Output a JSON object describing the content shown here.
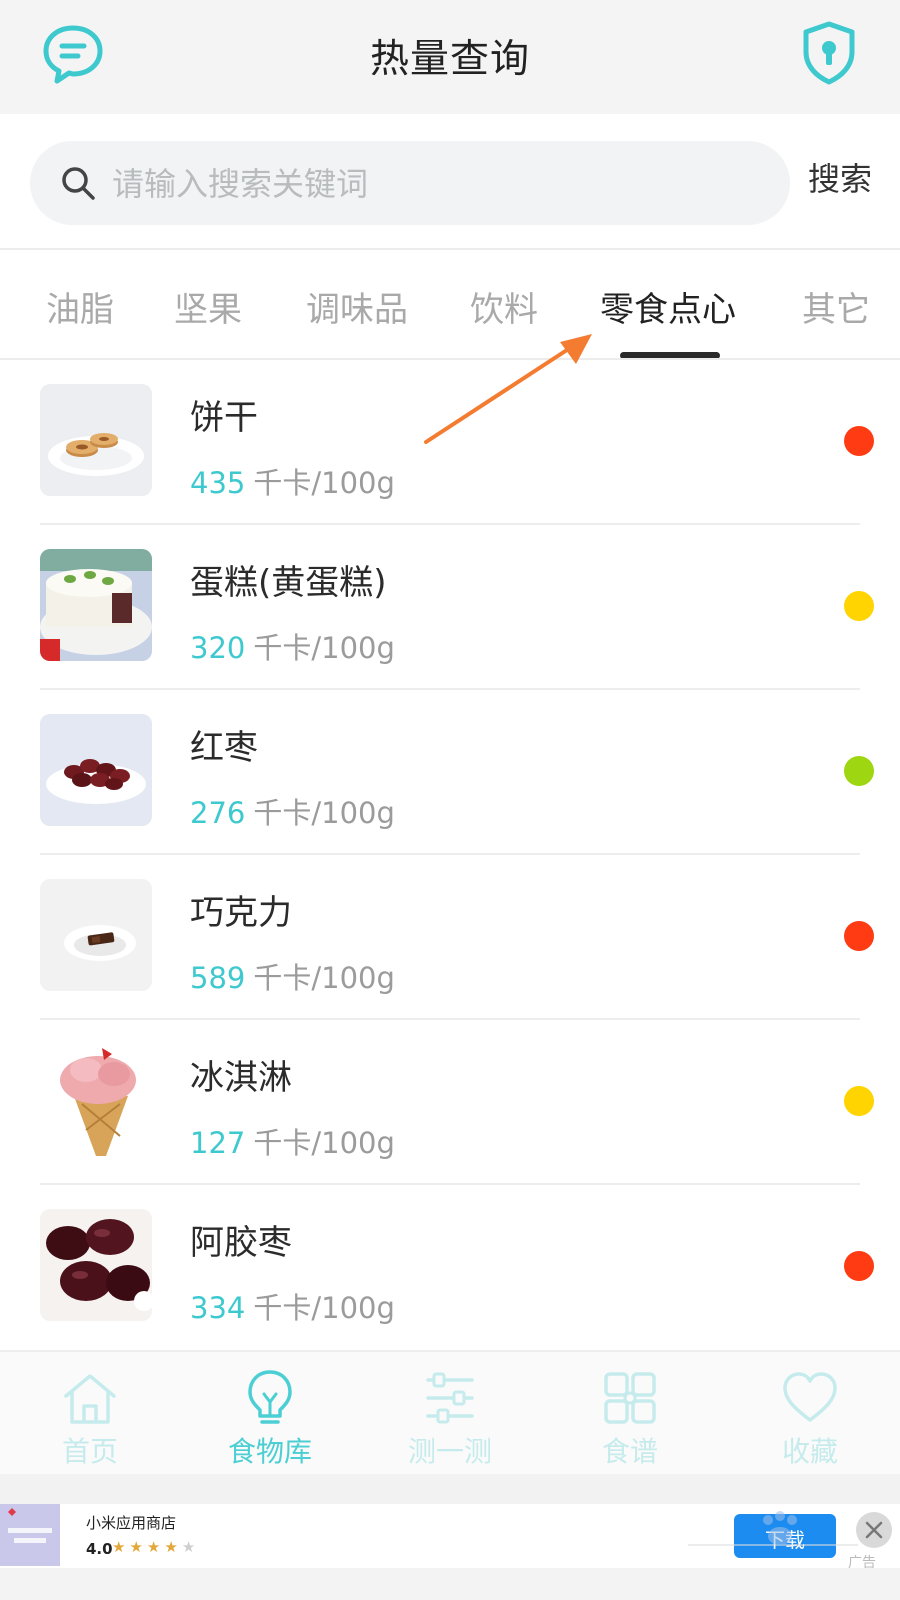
{
  "header": {
    "title": "热量查询",
    "left_icon": "message-icon",
    "right_icon": "shield-lock-icon"
  },
  "search": {
    "placeholder": "请输入搜索关键词",
    "value": "",
    "button_label": "搜索"
  },
  "tabs": [
    {
      "label": "油脂",
      "active": false
    },
    {
      "label": "坚果",
      "active": false
    },
    {
      "label": "调味品",
      "active": false
    },
    {
      "label": "饮料",
      "active": false
    },
    {
      "label": "零食点心",
      "active": true
    },
    {
      "label": "其它",
      "active": false
    }
  ],
  "foods": [
    {
      "name": "饼干",
      "kcal": "435",
      "unit": "千卡/100g",
      "level_color": "#ff3b14",
      "image": "biscuits"
    },
    {
      "name": "蛋糕(黄蛋糕)",
      "kcal": "320",
      "unit": "千卡/100g",
      "level_color": "#ffd400",
      "image": "cake"
    },
    {
      "name": "红枣",
      "kcal": "276",
      "unit": "千卡/100g",
      "level_color": "#9ed611",
      "image": "red-dates"
    },
    {
      "name": "巧克力",
      "kcal": "589",
      "unit": "千卡/100g",
      "level_color": "#ff3b14",
      "image": "chocolate"
    },
    {
      "name": "冰淇淋",
      "kcal": "127",
      "unit": "千卡/100g",
      "level_color": "#ffd400",
      "image": "ice-cream"
    },
    {
      "name": "阿胶枣",
      "kcal": "334",
      "unit": "千卡/100g",
      "level_color": "#ff3b14",
      "image": "ejiao-dates"
    }
  ],
  "bottom_nav": [
    {
      "label": "首页",
      "icon": "home-icon",
      "active": false
    },
    {
      "label": "食物库",
      "icon": "lightbulb-icon",
      "active": true
    },
    {
      "label": "测一测",
      "icon": "sliders-icon",
      "active": false
    },
    {
      "label": "食谱",
      "icon": "grid-icon",
      "active": false
    },
    {
      "label": "收藏",
      "icon": "heart-icon",
      "active": false
    }
  ],
  "ad": {
    "app_name": "小米应用商店",
    "rating": "4.0",
    "stars_filled": 4,
    "stars_total": 5,
    "button_label": "下载",
    "tag": "广告"
  },
  "colors": {
    "accent": "#3ec9cf",
    "text": "#222222",
    "muted": "#a9a9a9",
    "annotation_arrow": "#f47c30"
  }
}
